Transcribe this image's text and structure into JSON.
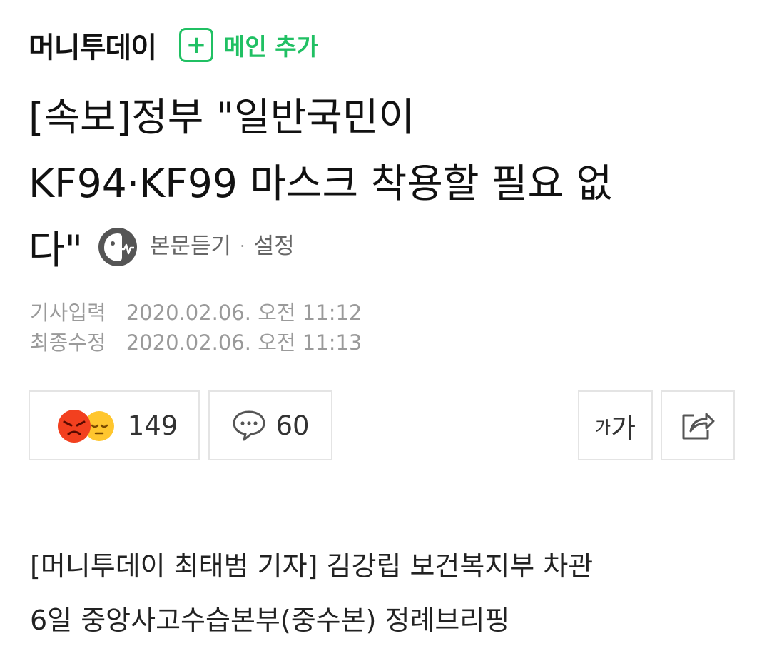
{
  "press": {
    "name": "머니투데이",
    "add_label": "메인 추가"
  },
  "headline": {
    "line1": "[속보]정부 \"일반국민이",
    "line2": "KF94·KF99 마스크 착용할 필요 없",
    "line3": "다\""
  },
  "tts": {
    "listen_label": "본문듣기",
    "separator": "·",
    "settings_label": "설정"
  },
  "dates": {
    "input_label": "기사입력",
    "input_value": "2020.02.06. 오전 11:12",
    "modified_label": "최종수정",
    "modified_value": "2020.02.06. 오전 11:13"
  },
  "actions": {
    "reaction_count": "149",
    "comment_count": "60",
    "font_small": "가",
    "font_large": "가"
  },
  "body": {
    "line1": "[머니투데이 최태범 기자] 김강립 보건복지부 차관",
    "line2": "6일 중앙사고수습본부(중수본) 정례브리핑"
  },
  "colors": {
    "accent_green": "#20c063",
    "angry_red": "#f2401f",
    "sad_yellow": "#ffc62e",
    "border": "#e4e4e4"
  }
}
